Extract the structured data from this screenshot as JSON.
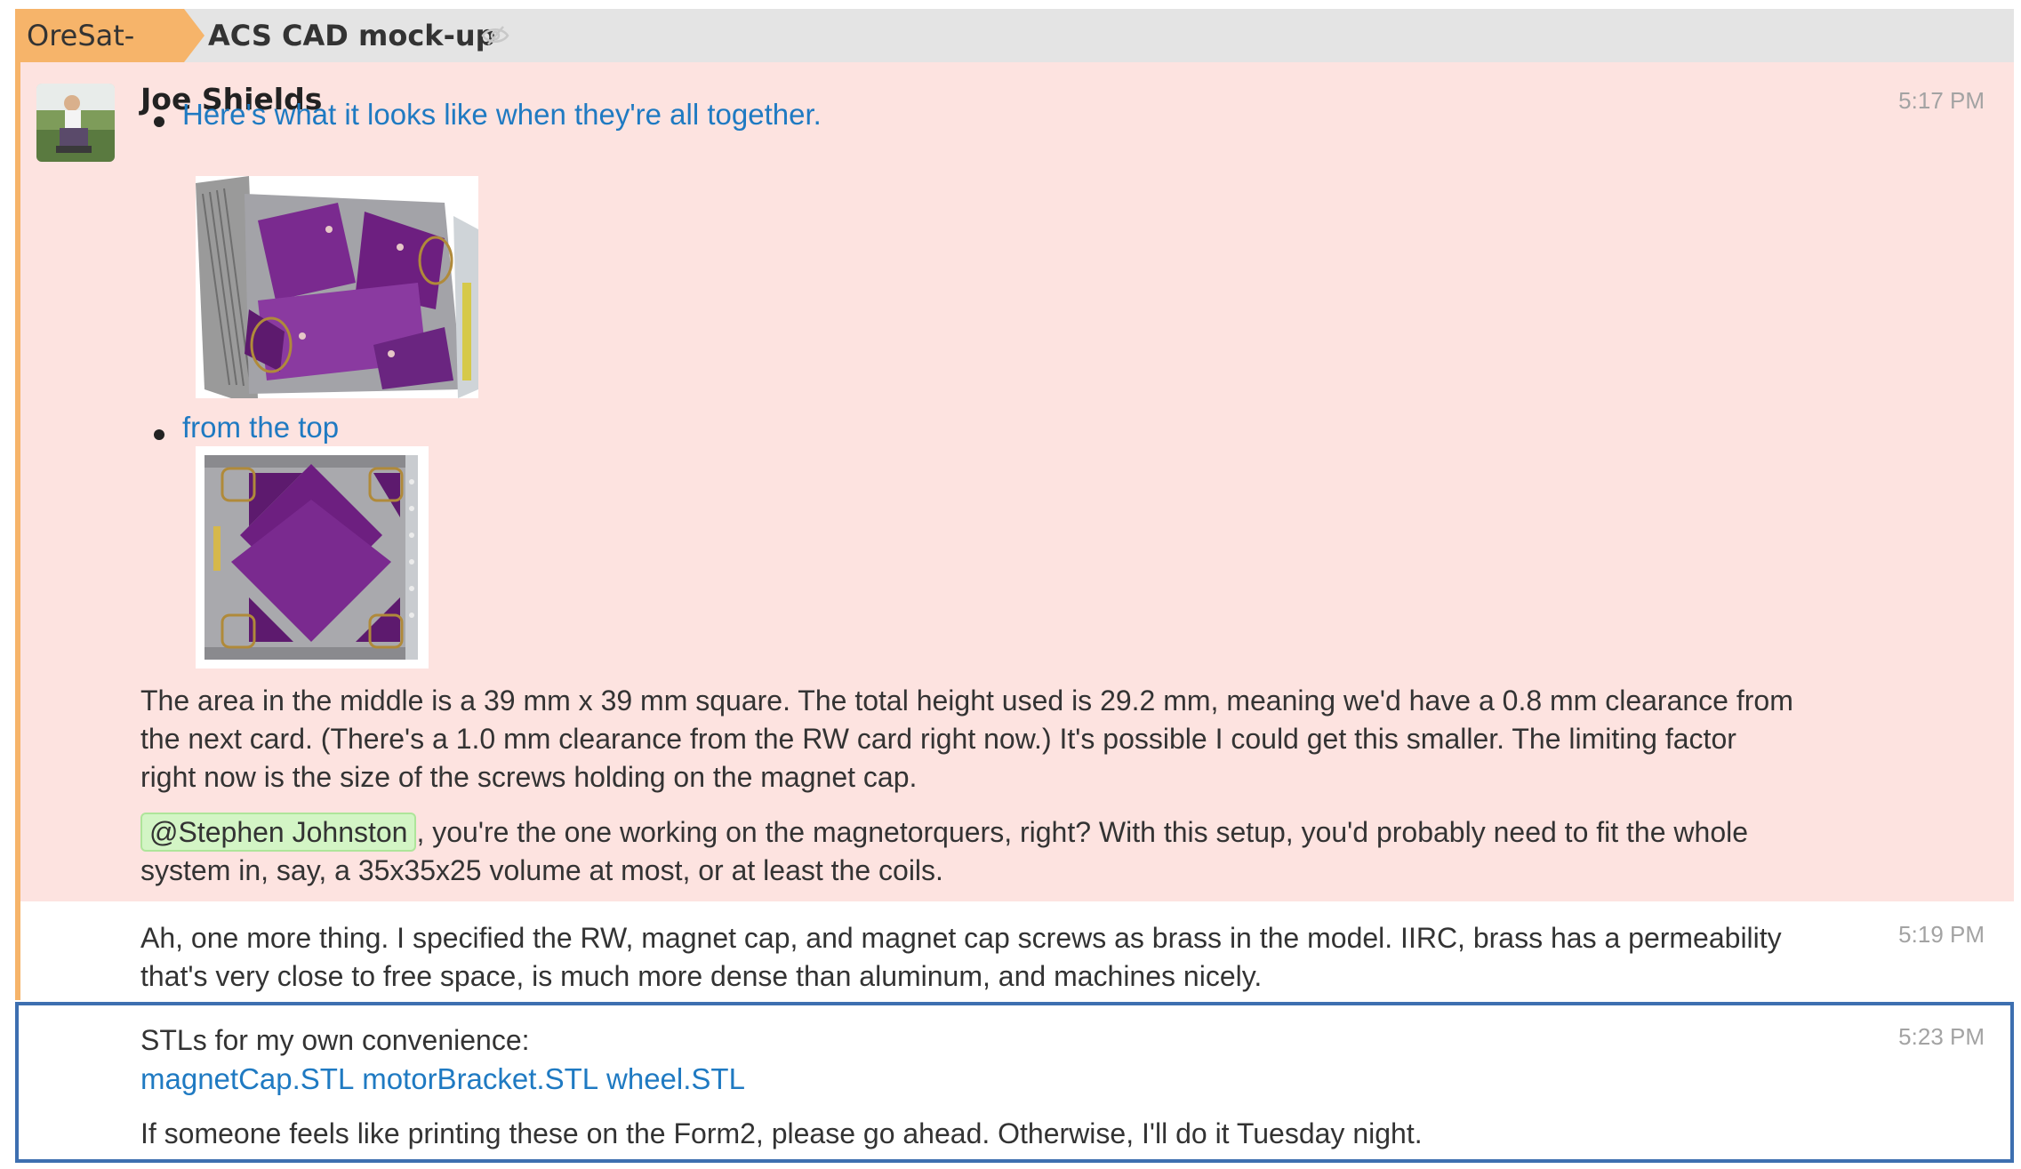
{
  "header": {
    "stream": "OreSat-ACS",
    "topic": "ACS CAD mock-up",
    "mute_icon": "eye-slash-icon",
    "stream_color": "#f6b46a"
  },
  "messages": [
    {
      "sender": "Joe Shields",
      "time": "5:17 PM",
      "background": "#fde3e0",
      "bullets": [
        {
          "link": "Here's what it looks like when they're all together.",
          "image": "CAD render – perspective view"
        },
        {
          "link": "from the top",
          "image": "CAD render – top view"
        }
      ],
      "paragraph1": "The area in the middle is a 39 mm x 39 mm square. The total height used is 29.2 mm, meaning we'd have a 0.8 mm clearance from the next card. (There's a 1.0 mm clearance from the RW card right now.) It's possible I could get this smaller. The limiting factor right now is the size of the screws holding on the magnet cap.",
      "mention": "@Stephen Johnston",
      "paragraph2": ", you're the one working on the magnetorquers, right? With this setup, you'd probably need to fit the whole system in, say, a 35x35x25 volume at most, or at least the coils."
    },
    {
      "time": "5:19 PM",
      "text": "Ah, one more thing. I specified the RW, magnet cap, and magnet cap screws as brass in the model. IIRC, brass has a permeability that's very close to free space, is much more dense than aluminum, and machines nicely."
    },
    {
      "time": "5:23 PM",
      "line1": "STLs for my own convenience:",
      "files": [
        "magnetCap.STL",
        "motorBracket.STL",
        "wheel.STL"
      ],
      "line2": "If someone feels like printing these on the Form2, please go ahead. Otherwise, I'll do it Tuesday night."
    }
  ]
}
